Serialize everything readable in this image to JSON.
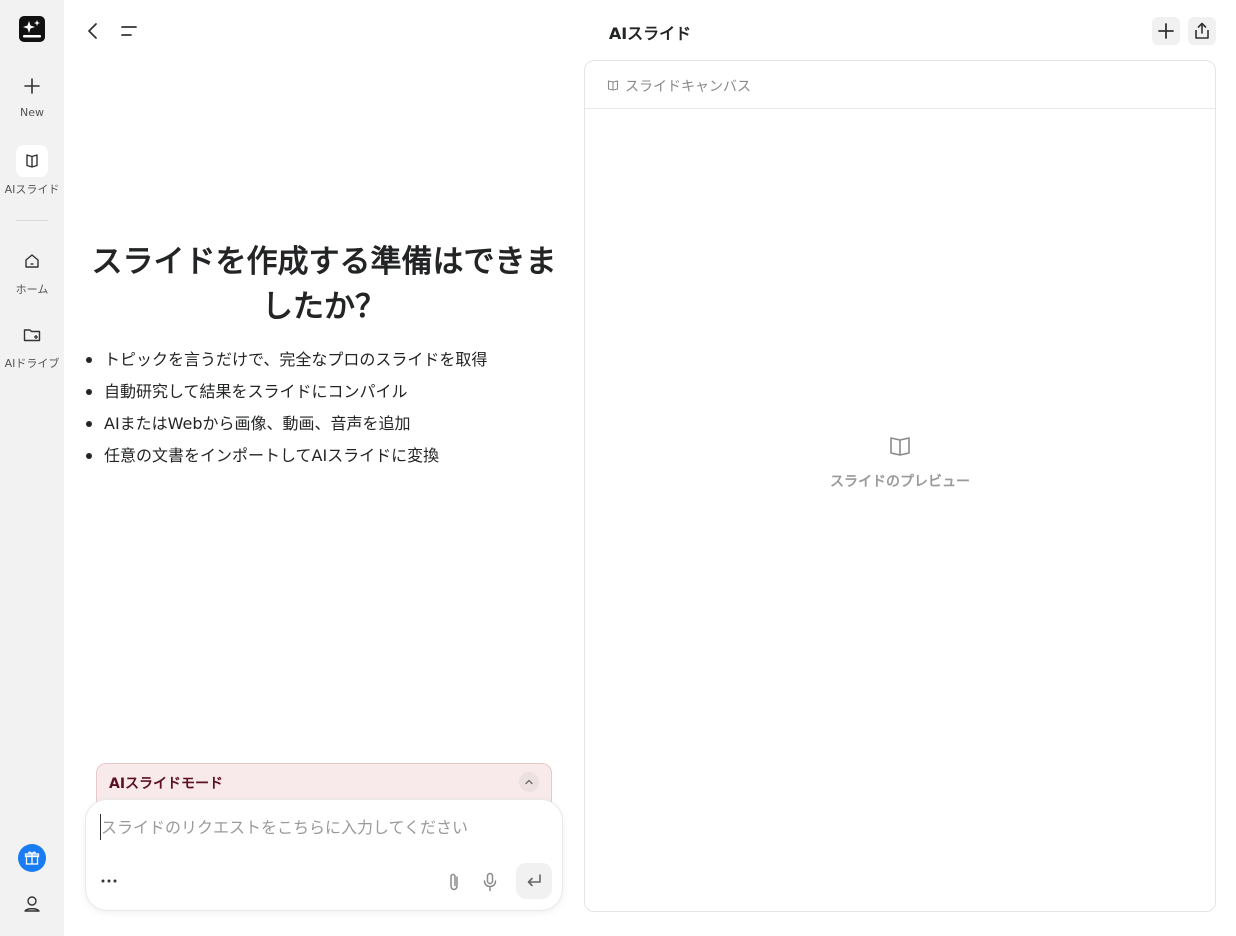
{
  "sidebar": {
    "logo_icon": "sparkle-logo-icon",
    "items": [
      {
        "label": "New",
        "icon": "plus-icon"
      },
      {
        "label": "AIスライド",
        "icon": "slides-icon",
        "active": true
      },
      {
        "label": "ホーム",
        "icon": "home-icon"
      },
      {
        "label": "AIドライブ",
        "icon": "drive-folder-icon"
      }
    ],
    "gift_icon": "gift-icon",
    "profile_icon": "user-icon",
    "accent_color": "#1a7cf2"
  },
  "header": {
    "title": "AIスライド",
    "back_icon": "chevron-left-icon",
    "menu_icon": "menu-icon",
    "new_icon": "plus-icon",
    "share_icon": "share-icon"
  },
  "main": {
    "headline": "スライドを作成する準備はできましたか？",
    "features": [
      "トピックを言うだけで、完全なプロのスライドを取得",
      "自動研究して結果をスライドにコンパイル",
      "AIまたはWebから画像、動画、音声を追加",
      "任意の文書をインポートしてAIスライドに変換"
    ]
  },
  "mode": {
    "label": "AIスライドモード",
    "color": "#5a1020",
    "background": "#f8eaea"
  },
  "composer": {
    "placeholder": "スライドのリクエストをこちらに入力してください",
    "value": "",
    "more_label": "…"
  },
  "canvas": {
    "title": "スライドキャンバス",
    "preview_label": "スライドのプレビュー"
  }
}
